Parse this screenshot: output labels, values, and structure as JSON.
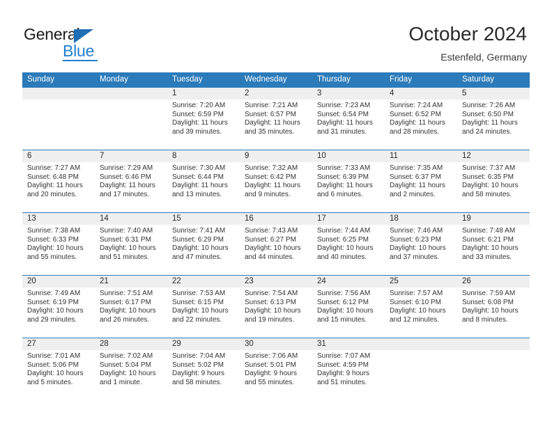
{
  "logo": {
    "word1": "General",
    "word2": "Blue",
    "triangle_color": "#1f6eb5",
    "blue_color": "#1f7fd0",
    "icon": "general-blue-logo"
  },
  "header": {
    "title": "October 2024",
    "subtitle": "Estenfeld, Germany"
  },
  "theme": {
    "header_blue": "#2b7bba",
    "day_band_gray": "#efefef",
    "text": "#333333"
  },
  "weekdays": [
    "Sunday",
    "Monday",
    "Tuesday",
    "Wednesday",
    "Thursday",
    "Friday",
    "Saturday"
  ],
  "weeks": [
    [
      {
        "day": "",
        "sunrise": "",
        "sunset": "",
        "daylight1": "",
        "daylight2": ""
      },
      {
        "day": "",
        "sunrise": "",
        "sunset": "",
        "daylight1": "",
        "daylight2": ""
      },
      {
        "day": "1",
        "sunrise": "Sunrise: 7:20 AM",
        "sunset": "Sunset: 6:59 PM",
        "daylight1": "Daylight: 11 hours",
        "daylight2": "and 39 minutes."
      },
      {
        "day": "2",
        "sunrise": "Sunrise: 7:21 AM",
        "sunset": "Sunset: 6:57 PM",
        "daylight1": "Daylight: 11 hours",
        "daylight2": "and 35 minutes."
      },
      {
        "day": "3",
        "sunrise": "Sunrise: 7:23 AM",
        "sunset": "Sunset: 6:54 PM",
        "daylight1": "Daylight: 11 hours",
        "daylight2": "and 31 minutes."
      },
      {
        "day": "4",
        "sunrise": "Sunrise: 7:24 AM",
        "sunset": "Sunset: 6:52 PM",
        "daylight1": "Daylight: 11 hours",
        "daylight2": "and 28 minutes."
      },
      {
        "day": "5",
        "sunrise": "Sunrise: 7:26 AM",
        "sunset": "Sunset: 6:50 PM",
        "daylight1": "Daylight: 11 hours",
        "daylight2": "and 24 minutes."
      }
    ],
    [
      {
        "day": "6",
        "sunrise": "Sunrise: 7:27 AM",
        "sunset": "Sunset: 6:48 PM",
        "daylight1": "Daylight: 11 hours",
        "daylight2": "and 20 minutes."
      },
      {
        "day": "7",
        "sunrise": "Sunrise: 7:29 AM",
        "sunset": "Sunset: 6:46 PM",
        "daylight1": "Daylight: 11 hours",
        "daylight2": "and 17 minutes."
      },
      {
        "day": "8",
        "sunrise": "Sunrise: 7:30 AM",
        "sunset": "Sunset: 6:44 PM",
        "daylight1": "Daylight: 11 hours",
        "daylight2": "and 13 minutes."
      },
      {
        "day": "9",
        "sunrise": "Sunrise: 7:32 AM",
        "sunset": "Sunset: 6:42 PM",
        "daylight1": "Daylight: 11 hours",
        "daylight2": "and 9 minutes."
      },
      {
        "day": "10",
        "sunrise": "Sunrise: 7:33 AM",
        "sunset": "Sunset: 6:39 PM",
        "daylight1": "Daylight: 11 hours",
        "daylight2": "and 6 minutes."
      },
      {
        "day": "11",
        "sunrise": "Sunrise: 7:35 AM",
        "sunset": "Sunset: 6:37 PM",
        "daylight1": "Daylight: 11 hours",
        "daylight2": "and 2 minutes."
      },
      {
        "day": "12",
        "sunrise": "Sunrise: 7:37 AM",
        "sunset": "Sunset: 6:35 PM",
        "daylight1": "Daylight: 10 hours",
        "daylight2": "and 58 minutes."
      }
    ],
    [
      {
        "day": "13",
        "sunrise": "Sunrise: 7:38 AM",
        "sunset": "Sunset: 6:33 PM",
        "daylight1": "Daylight: 10 hours",
        "daylight2": "and 55 minutes."
      },
      {
        "day": "14",
        "sunrise": "Sunrise: 7:40 AM",
        "sunset": "Sunset: 6:31 PM",
        "daylight1": "Daylight: 10 hours",
        "daylight2": "and 51 minutes."
      },
      {
        "day": "15",
        "sunrise": "Sunrise: 7:41 AM",
        "sunset": "Sunset: 6:29 PM",
        "daylight1": "Daylight: 10 hours",
        "daylight2": "and 47 minutes."
      },
      {
        "day": "16",
        "sunrise": "Sunrise: 7:43 AM",
        "sunset": "Sunset: 6:27 PM",
        "daylight1": "Daylight: 10 hours",
        "daylight2": "and 44 minutes."
      },
      {
        "day": "17",
        "sunrise": "Sunrise: 7:44 AM",
        "sunset": "Sunset: 6:25 PM",
        "daylight1": "Daylight: 10 hours",
        "daylight2": "and 40 minutes."
      },
      {
        "day": "18",
        "sunrise": "Sunrise: 7:46 AM",
        "sunset": "Sunset: 6:23 PM",
        "daylight1": "Daylight: 10 hours",
        "daylight2": "and 37 minutes."
      },
      {
        "day": "19",
        "sunrise": "Sunrise: 7:48 AM",
        "sunset": "Sunset: 6:21 PM",
        "daylight1": "Daylight: 10 hours",
        "daylight2": "and 33 minutes."
      }
    ],
    [
      {
        "day": "20",
        "sunrise": "Sunrise: 7:49 AM",
        "sunset": "Sunset: 6:19 PM",
        "daylight1": "Daylight: 10 hours",
        "daylight2": "and 29 minutes."
      },
      {
        "day": "21",
        "sunrise": "Sunrise: 7:51 AM",
        "sunset": "Sunset: 6:17 PM",
        "daylight1": "Daylight: 10 hours",
        "daylight2": "and 26 minutes."
      },
      {
        "day": "22",
        "sunrise": "Sunrise: 7:53 AM",
        "sunset": "Sunset: 6:15 PM",
        "daylight1": "Daylight: 10 hours",
        "daylight2": "and 22 minutes."
      },
      {
        "day": "23",
        "sunrise": "Sunrise: 7:54 AM",
        "sunset": "Sunset: 6:13 PM",
        "daylight1": "Daylight: 10 hours",
        "daylight2": "and 19 minutes."
      },
      {
        "day": "24",
        "sunrise": "Sunrise: 7:56 AM",
        "sunset": "Sunset: 6:12 PM",
        "daylight1": "Daylight: 10 hours",
        "daylight2": "and 15 minutes."
      },
      {
        "day": "25",
        "sunrise": "Sunrise: 7:57 AM",
        "sunset": "Sunset: 6:10 PM",
        "daylight1": "Daylight: 10 hours",
        "daylight2": "and 12 minutes."
      },
      {
        "day": "26",
        "sunrise": "Sunrise: 7:59 AM",
        "sunset": "Sunset: 6:08 PM",
        "daylight1": "Daylight: 10 hours",
        "daylight2": "and 8 minutes."
      }
    ],
    [
      {
        "day": "27",
        "sunrise": "Sunrise: 7:01 AM",
        "sunset": "Sunset: 5:06 PM",
        "daylight1": "Daylight: 10 hours",
        "daylight2": "and 5 minutes."
      },
      {
        "day": "28",
        "sunrise": "Sunrise: 7:02 AM",
        "sunset": "Sunset: 5:04 PM",
        "daylight1": "Daylight: 10 hours",
        "daylight2": "and 1 minute."
      },
      {
        "day": "29",
        "sunrise": "Sunrise: 7:04 AM",
        "sunset": "Sunset: 5:02 PM",
        "daylight1": "Daylight: 9 hours",
        "daylight2": "and 58 minutes."
      },
      {
        "day": "30",
        "sunrise": "Sunrise: 7:06 AM",
        "sunset": "Sunset: 5:01 PM",
        "daylight1": "Daylight: 9 hours",
        "daylight2": "and 55 minutes."
      },
      {
        "day": "31",
        "sunrise": "Sunrise: 7:07 AM",
        "sunset": "Sunset: 4:59 PM",
        "daylight1": "Daylight: 9 hours",
        "daylight2": "and 51 minutes."
      },
      {
        "day": "",
        "sunrise": "",
        "sunset": "",
        "daylight1": "",
        "daylight2": ""
      },
      {
        "day": "",
        "sunrise": "",
        "sunset": "",
        "daylight1": "",
        "daylight2": ""
      }
    ]
  ]
}
